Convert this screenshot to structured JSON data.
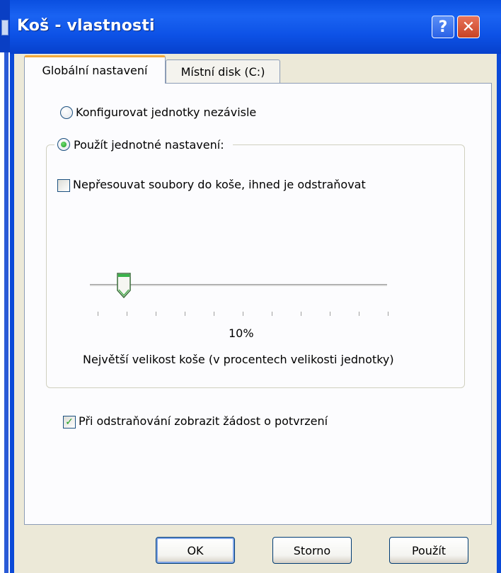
{
  "window": {
    "title": "Koš - vlastnosti",
    "help_glyph": "?",
    "close_glyph": "✕"
  },
  "tabs": [
    {
      "label": "Globální nastavení",
      "active": true
    },
    {
      "label": "Místní disk (C:)",
      "active": false
    }
  ],
  "options": {
    "configure_independently": {
      "label": "Konfigurovat jednotky nezávisle",
      "selected": false
    },
    "use_uniform": {
      "label": "Použít jednotné nastavení:",
      "selected": true
    }
  },
  "group": {
    "delete_immediately": {
      "label": "Nepřesouvat soubory do koše, ihned je odstraňovat",
      "checked": false
    },
    "slider": {
      "value_label": "10%",
      "value_percent": 10,
      "caption": "Největší velikost koše (v procentech velikosti jednotky)"
    }
  },
  "confirm_delete": {
    "label": "Při odstraňování zobrazit žádost o potvrzení",
    "checked": true,
    "check_glyph": "✓"
  },
  "buttons": {
    "ok": "OK",
    "cancel": "Storno",
    "apply": "Použít"
  },
  "colors": {
    "titlebar": "#0b4ad8",
    "dialog_bg": "#ece9d8",
    "tab_accent": "#f2a93b",
    "check_green": "#21a121"
  }
}
